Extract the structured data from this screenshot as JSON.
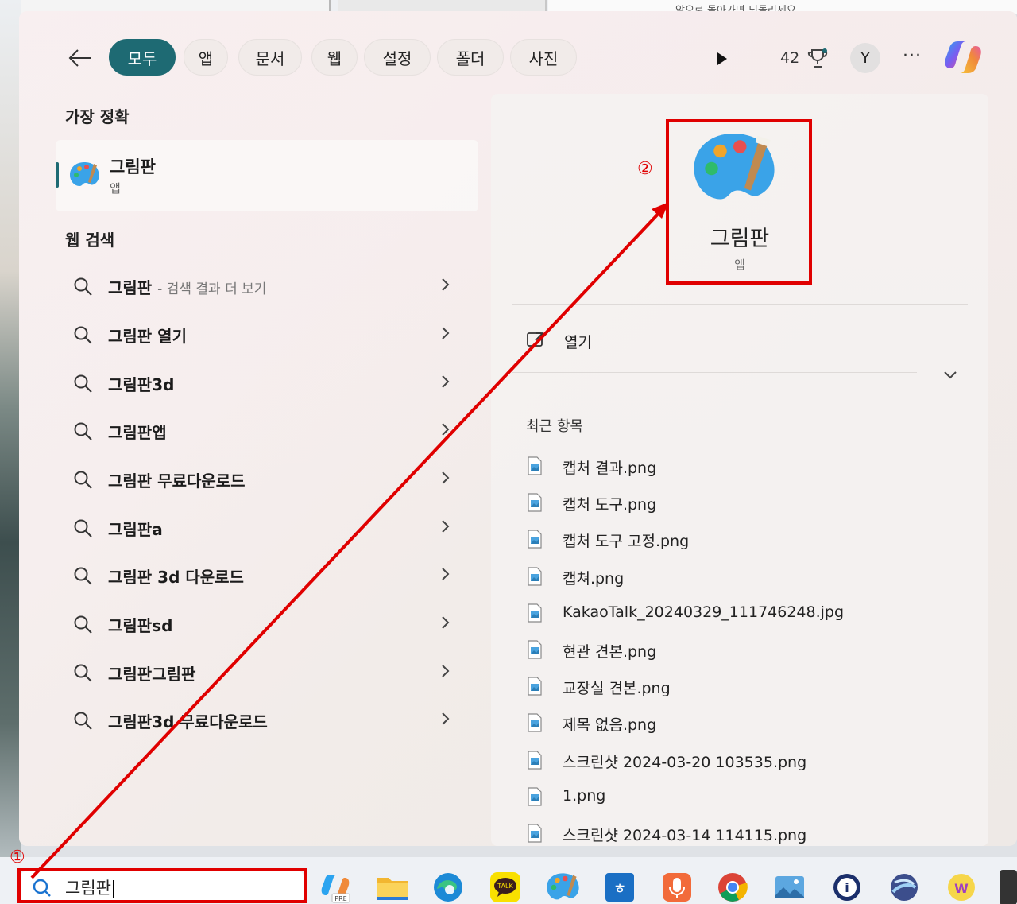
{
  "tabs": [
    {
      "label": "모두",
      "active": true
    },
    {
      "label": "앱"
    },
    {
      "label": "문서"
    },
    {
      "label": "웹"
    },
    {
      "label": "설정"
    },
    {
      "label": "폴더"
    },
    {
      "label": "사진"
    }
  ],
  "header": {
    "points": "42",
    "avatar": "Y",
    "more": "···",
    "background_text": "앞으로 돌아가면 되돌리세요"
  },
  "best_match": {
    "title": "가장 정확",
    "name": "그림판",
    "kind": "앱"
  },
  "web": {
    "title": "웹 검색",
    "items": [
      {
        "text": "그림판",
        "sub": "- 검색 결과 더 보기"
      },
      {
        "text": "그림판 열기"
      },
      {
        "text": "그림판3d"
      },
      {
        "text": "그림판앱"
      },
      {
        "text": "그림판 무료다운로드"
      },
      {
        "text": "그림판a"
      },
      {
        "text": "그림판 3d 다운로드"
      },
      {
        "text": "그림판sd"
      },
      {
        "text": "그림판그림판"
      },
      {
        "text": "그림판3d 무료다운로드"
      }
    ]
  },
  "detail": {
    "name": "그림판",
    "kind": "앱",
    "open_label": "열기",
    "recent_title": "최근 항목"
  },
  "recent_files": [
    "캡처 결과.png",
    "캡처 도구.png",
    "캡처 도구 고정.png",
    "캡쳐.png",
    "KakaoTalk_20240329_111746248.jpg",
    "현관 견본.png",
    "교장실 견본.png",
    "제목 없음.png",
    "스크린샷 2024-03-20 103535.png",
    "1.png",
    "스크린샷 2024-03-14 114115.png"
  ],
  "search": {
    "value": "그림판"
  },
  "annotations": {
    "step1": "①",
    "step2": "②",
    "color": "#e00000"
  },
  "colors": {
    "accent": "#1e6a73"
  },
  "taskbar_icons": [
    "copilot-pre-icon",
    "file-explorer-icon",
    "edge-icon",
    "kakaotalk-icon",
    "paint-icon",
    "hangul-icon",
    "recorder-icon",
    "chrome-icon",
    "photos-icon",
    "app-icon",
    "wallpaper-icon",
    "store-icon"
  ]
}
